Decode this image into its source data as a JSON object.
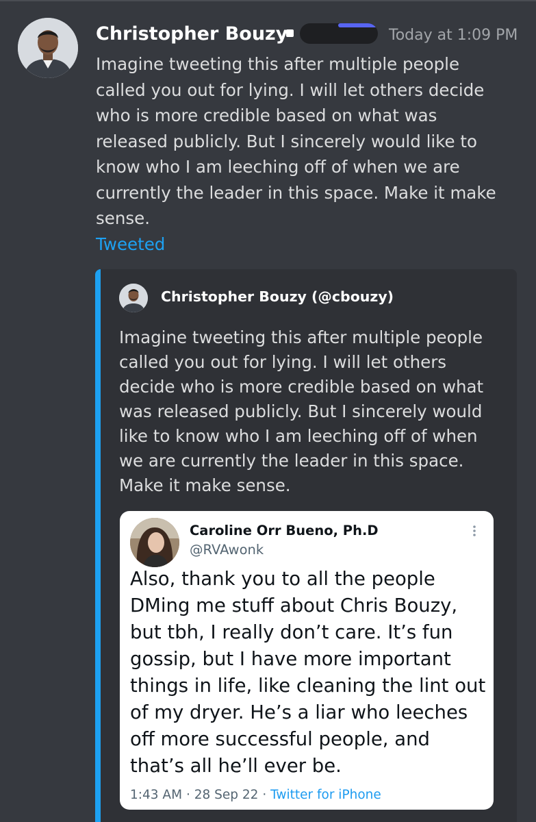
{
  "message": {
    "author": "Christopher Bouzy",
    "timestamp": "Today at 1:09 PM",
    "lines": [
      "Imagine tweeting this after multiple people",
      "called you out for lying. I will let others decide",
      "who is more credible based on what was",
      "released publicly. But I sincerely would like to",
      "know who I am leeching off of when we are",
      "currently the leader in this space. Make it make",
      "sense."
    ],
    "link_label": "Tweeted",
    "colors": {
      "link": "#1da1f2",
      "accent_bar": "#1da1f2",
      "redaction_accent": "#5865f2"
    }
  },
  "embed": {
    "author": "Christopher Bouzy (@cbouzy)",
    "lines": [
      "Imagine tweeting this after multiple people",
      "called you out for lying. I will let others",
      "decide who is more credible based on what",
      "was released publicly. But I sincerely would",
      "like to know who I am leeching off of when",
      "we are currently the leader in this space.",
      "Make it make sense."
    ],
    "quoted_tweet": {
      "name": "Caroline Orr Bueno, Ph.D",
      "handle": "@RVAwonk",
      "more_icon": "more-vertical-icon",
      "lines": [
        "Also, thank you to all the people",
        "DMing me stuff about Chris Bouzy,",
        "but tbh, I really don’t care. It’s fun",
        "gossip, but I have more important",
        "things in life, like cleaning the lint out",
        "of my dryer. He’s a liar who leeches",
        "off more successful people, and",
        "that’s all he’ll ever be."
      ],
      "time": "1:43 AM",
      "separator": "·",
      "date": "28 Sep 22",
      "source": "Twitter for iPhone"
    }
  }
}
